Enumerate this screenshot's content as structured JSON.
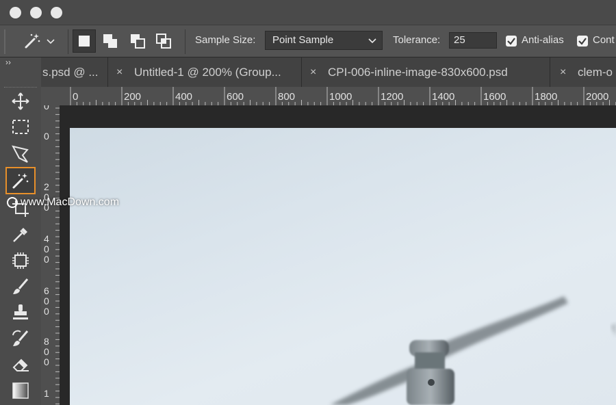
{
  "window": {
    "traffic_lights": [
      "close",
      "minimize",
      "zoom"
    ]
  },
  "options_bar": {
    "tool_icon": "magic-wand-icon",
    "selection_modes": [
      "new-selection-icon",
      "add-to-selection-icon",
      "subtract-from-selection-icon",
      "intersect-selection-icon"
    ],
    "sample_size_label": "Sample Size:",
    "sample_size_value": "Point Sample",
    "tolerance_label": "Tolerance:",
    "tolerance_value": "25",
    "anti_alias_label": "Anti-alias",
    "contiguous_label": "Cont"
  },
  "tabs": {
    "collapse": "››",
    "items": [
      {
        "label": "s.psd @ ..."
      },
      {
        "label": "Untitled-1 @ 200% (Group..."
      },
      {
        "label": "CPI-006-inline-image-830x600.psd"
      },
      {
        "label": "clem-o"
      }
    ],
    "close_glyph": "×"
  },
  "toolbar": {
    "items": [
      "move-icon",
      "marquee-icon",
      "lasso-icon",
      "magic-wand-icon",
      "crop-icon",
      "eyedropper-icon",
      "frame-icon",
      "brush-icon",
      "stamp-icon",
      "history-brush-icon",
      "eraser-icon",
      "gradient-icon"
    ],
    "active": "magic-wand-icon"
  },
  "rulers": {
    "horizontal": [
      "0",
      "200",
      "400",
      "600",
      "800",
      "1000",
      "1200",
      "1400",
      "1600",
      "1800",
      "2000"
    ],
    "vertical": [
      "0",
      "0",
      "200",
      "400",
      "600",
      "800",
      "1"
    ]
  },
  "watermark": "www.MacDown.com",
  "colors": {
    "accent_active_tool": "#e8902a",
    "panel": "#535353",
    "canvas": "#282828"
  }
}
